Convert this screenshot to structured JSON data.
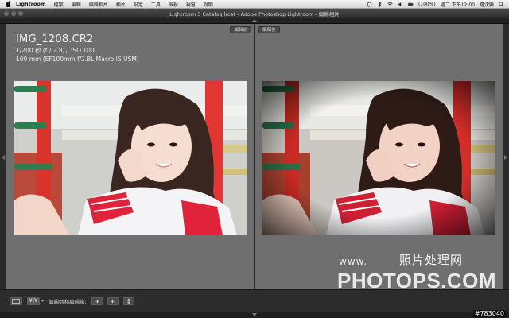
{
  "menubar": {
    "app_name": "Lightroom",
    "items": [
      "檔案",
      "編輯",
      "編輯相片",
      "相片",
      "設定",
      "工具",
      "檢視",
      "視窗",
      "說明"
    ],
    "battery": "(100%)",
    "clock": "週二 下午12:00",
    "user": "鍾沈縣"
  },
  "window": {
    "title": "Lightroom 3 Catalog.lrcat - Adobe Photoshop Lightroom - 編輯相片"
  },
  "before_pane": {
    "tag": "編輯前",
    "filename": "IMG_1208.CR2",
    "exposure": "1/200 秒 (f / 2.8)，ISO 100",
    "lens": "100 mm (EF100mm f/2.8L Macro IS USM)"
  },
  "after_pane": {
    "tag": "編輯後"
  },
  "toolbar": {
    "compare_mode": "Y|Y",
    "label": "編輯前和編輯後:"
  },
  "watermark": {
    "www": "www.",
    "cn": "照片处理网",
    "site": "PHOTOPS.COM"
  },
  "image_id": "#783040",
  "colors": {
    "panel": "#6f6f6f",
    "background": "#1a1a1a",
    "toolbar": "#2c2c2c"
  }
}
